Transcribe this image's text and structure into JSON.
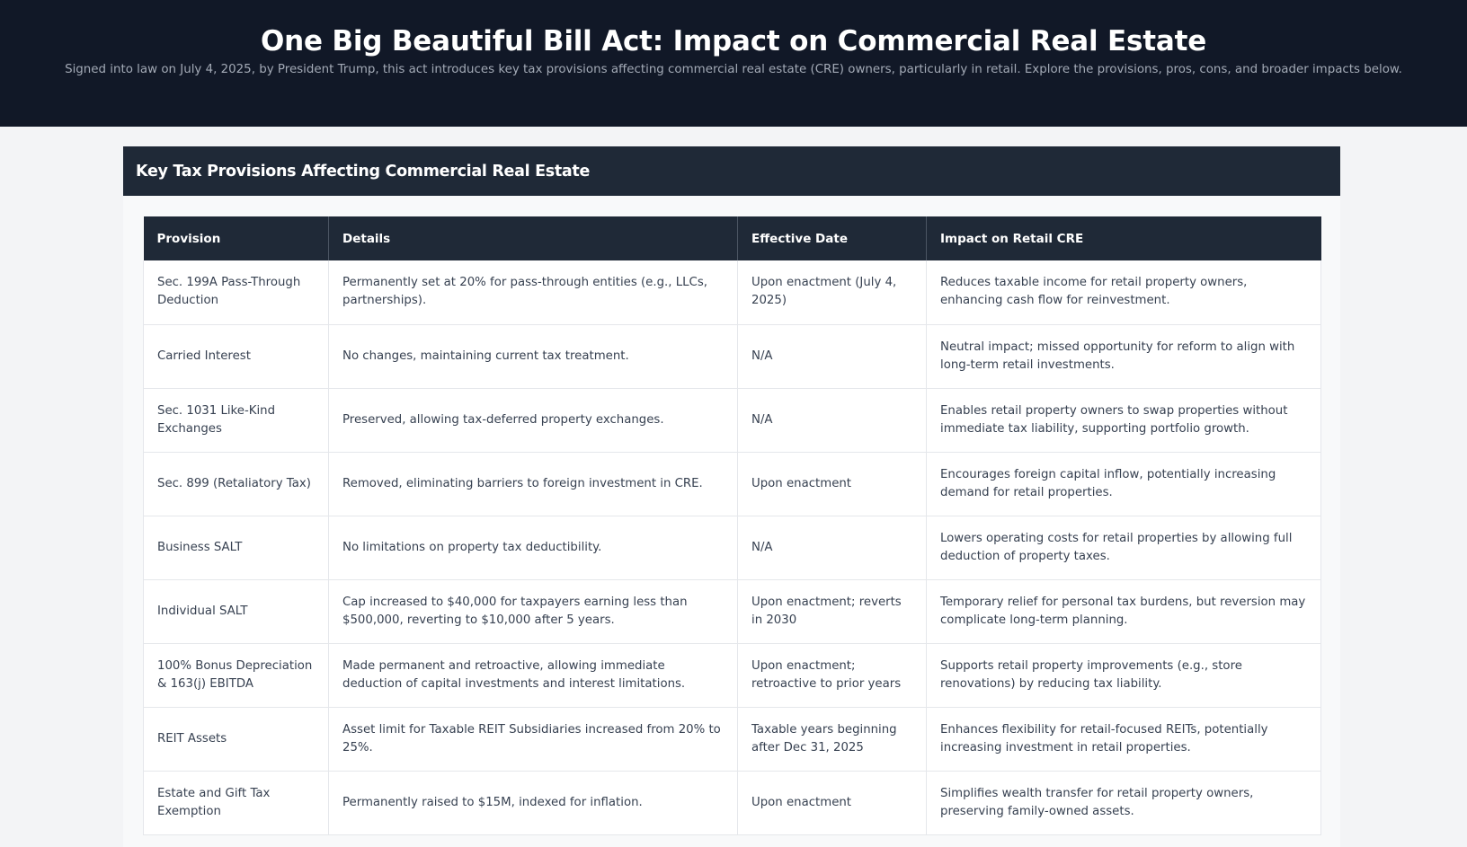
{
  "header": {
    "title": "One Big Beautiful Bill Act: Impact on Commercial Real Estate",
    "subtitle": "Signed into law on July 4, 2025, by President Trump, this act introduces key tax provisions affecting commercial real estate (CRE) owners, particularly in retail. Explore the provisions, pros, cons, and broader impacts below."
  },
  "section": {
    "title": "Key Tax Provisions Affecting Commercial Real Estate"
  },
  "table": {
    "columns": [
      "Provision",
      "Details",
      "Effective Date",
      "Impact on Retail CRE"
    ],
    "rows": [
      [
        "Sec. 199A Pass-Through Deduction",
        "Permanently set at 20% for pass-through entities (e.g., LLCs, partnerships).",
        "Upon enactment (July 4, 2025)",
        "Reduces taxable income for retail property owners, enhancing cash flow for reinvestment."
      ],
      [
        "Carried Interest",
        "No changes, maintaining current tax treatment.",
        "N/A",
        "Neutral impact; missed opportunity for reform to align with long-term retail investments."
      ],
      [
        "Sec. 1031 Like-Kind Exchanges",
        "Preserved, allowing tax-deferred property exchanges.",
        "N/A",
        "Enables retail property owners to swap properties without immediate tax liability, supporting portfolio growth."
      ],
      [
        "Sec. 899 (Retaliatory Tax)",
        "Removed, eliminating barriers to foreign investment in CRE.",
        "Upon enactment",
        "Encourages foreign capital inflow, potentially increasing demand for retail properties."
      ],
      [
        "Business SALT",
        "No limitations on property tax deductibility.",
        "N/A",
        "Lowers operating costs for retail properties by allowing full deduction of property taxes."
      ],
      [
        "Individual SALT",
        "Cap increased to $40,000 for taxpayers earning less than $500,000, reverting to $10,000 after 5 years.",
        "Upon enactment; reverts in 2030",
        "Temporary relief for personal tax burdens, but reversion may complicate long-term planning."
      ],
      [
        "100% Bonus Depreciation & 163(j) EBITDA",
        "Made permanent and retroactive, allowing immediate deduction of capital investments and interest limitations.",
        "Upon enactment; retroactive to prior years",
        "Supports retail property improvements (e.g., store renovations) by reducing tax liability."
      ],
      [
        "REIT Assets",
        "Asset limit for Taxable REIT Subsidiaries increased from 20% to 25%.",
        "Taxable years beginning after Dec 31, 2025",
        "Enhances flexibility for retail-focused REITs, potentially increasing investment in retail properties."
      ],
      [
        "Estate and Gift Tax Exemption",
        "Permanently raised to $15M, indexed for inflation.",
        "Upon enactment",
        "Simplifies wealth transfer for retail property owners, preserving family-owned assets."
      ]
    ]
  }
}
